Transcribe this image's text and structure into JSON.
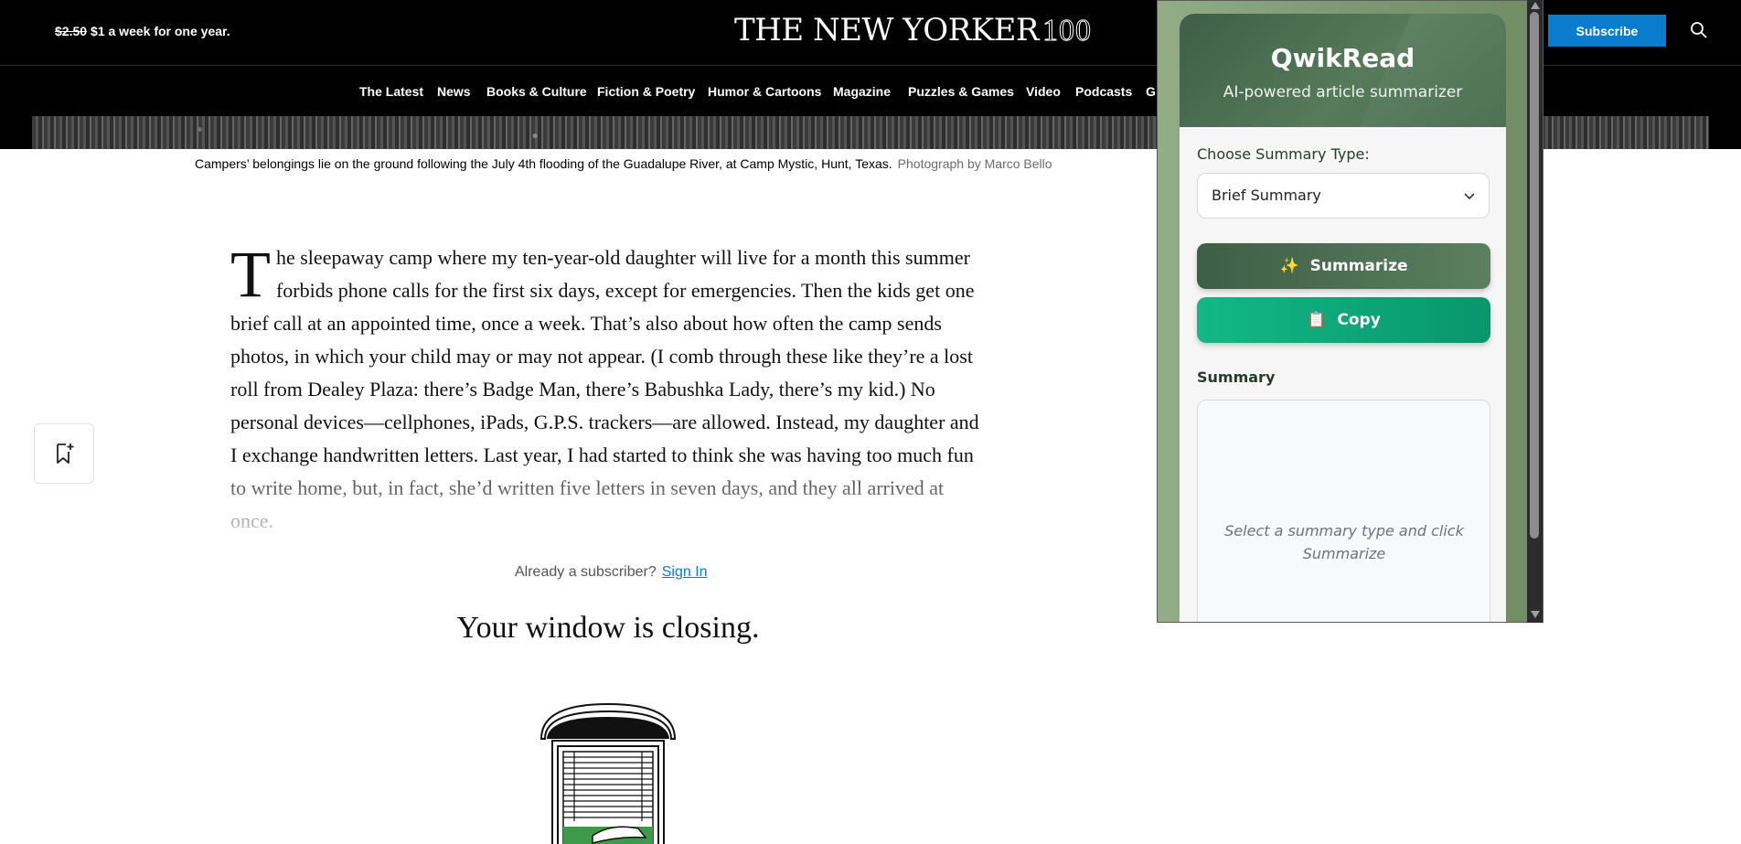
{
  "header": {
    "promo_old_price": "$2.50",
    "promo_text": "$1 a week for one year.",
    "logo": "THE NEW YORKER",
    "logo_anniversary": "100",
    "subscribe_label": "Subscribe"
  },
  "nav": {
    "items": [
      "The Latest",
      "News",
      "Books & Culture",
      "Fiction & Poetry",
      "Humor & Cartoons",
      "Magazine",
      "Puzzles & Games",
      "Video",
      "Podcasts",
      "G"
    ]
  },
  "caption": {
    "text": "Campers’ belongings lie on the ground following the July 4th flooding of the Guadalupe River, at Camp Mystic, Hunt, Texas.",
    "credit": "Photograph by Marco Bello"
  },
  "article": {
    "dropcap": "T",
    "body": "he sleepaway camp where my ten-year-old daughter will live for a month this summer forbids phone calls for the first six days, except for emergencies. Then the kids get one brief call at an appointed time, once a week. That’s also about how often the camp sends photos, in which your child may or may not appear. (I comb through these like they’re a lost roll from Dealey Plaza: there’s Badge Man, there’s Babushka Lady, there’s my kid.) No personal devices—cellphones, iPads, G.P.S. trackers—are allowed. Instead, my daughter and I exchange handwritten letters. Last year, I had started to think she was having too much fun to write home, but, in fact, she’d written five letters in seven days, and they all arrived at once."
  },
  "paywall": {
    "already_text": "Already a subscriber?",
    "sign_in": "Sign In",
    "headline": "Your window is closing."
  },
  "extension": {
    "title": "QwikRead",
    "subtitle": "AI-powered article summarizer",
    "choose_label": "Choose Summary Type:",
    "selected_type": "Brief Summary",
    "summarize_icon": "✨",
    "summarize_label": "Summarize",
    "copy_icon": "📋",
    "copy_label": "Copy",
    "summary_label": "Summary",
    "summary_placeholder": "Select a summary type and click Summarize"
  },
  "colors": {
    "brand_blue": "#0a7ccd",
    "extension_green": "#3f5e46",
    "copy_green": "#12b886"
  }
}
